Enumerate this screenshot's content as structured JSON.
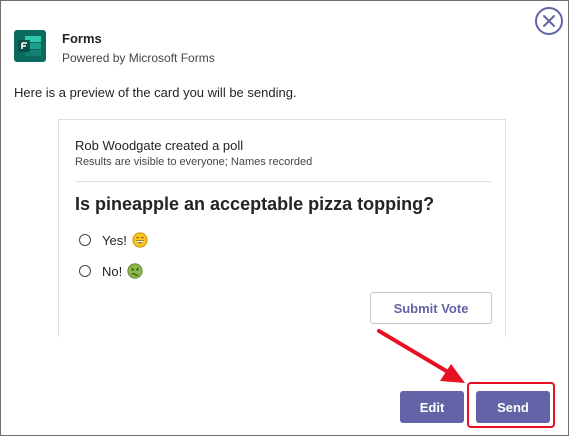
{
  "app": {
    "name": "Forms",
    "subtitle": "Powered by Microsoft Forms"
  },
  "intro_text": "Here is a preview of the card you will be sending.",
  "card": {
    "creator": "Rob Woodgate created a poll",
    "meta": "Results are visible to everyone; Names recorded",
    "question": "Is pineapple an acceptable pizza topping?",
    "options": [
      {
        "label": "Yes!",
        "emoji": "grinning-face-icon"
      },
      {
        "label": "No!",
        "emoji": "nauseated-face-icon"
      }
    ],
    "submit_label": "Submit Vote"
  },
  "actions": {
    "edit_label": "Edit",
    "send_label": "Send"
  },
  "colors": {
    "accent": "#6264a7",
    "highlight": "#e81123",
    "forms_green": "#077568"
  }
}
